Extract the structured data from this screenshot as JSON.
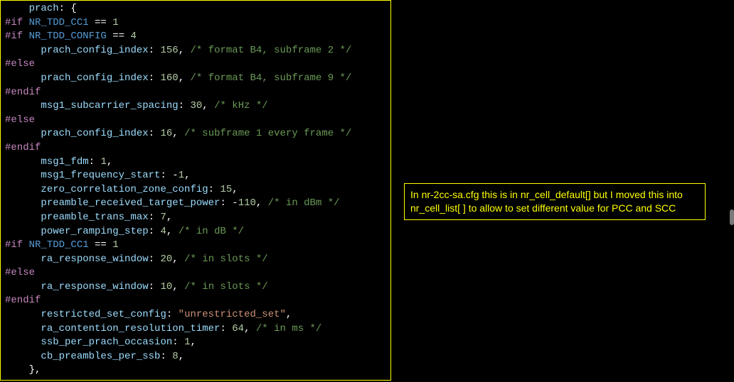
{
  "code": {
    "lines": [
      [
        [
          "tok-default",
          "    "
        ],
        [
          "tok-key",
          "prach"
        ],
        [
          "tok-default",
          ": {"
        ]
      ],
      [
        [
          "tok-preproc",
          "#if "
        ],
        [
          "tok-macro",
          "NR_TDD_CC1"
        ],
        [
          "tok-default",
          " == "
        ],
        [
          "tok-num",
          "1"
        ]
      ],
      [
        [
          "tok-preproc",
          "#if "
        ],
        [
          "tok-macro",
          "NR_TDD_CONFIG"
        ],
        [
          "tok-default",
          " == "
        ],
        [
          "tok-num",
          "4"
        ]
      ],
      [
        [
          "tok-default",
          "      "
        ],
        [
          "tok-key",
          "prach_config_index"
        ],
        [
          "tok-default",
          ": "
        ],
        [
          "tok-num",
          "156"
        ],
        [
          "tok-default",
          ", "
        ],
        [
          "tok-comment",
          "/* format B4, subframe 2 */"
        ]
      ],
      [
        [
          "tok-preproc",
          "#else"
        ]
      ],
      [
        [
          "tok-default",
          "      "
        ],
        [
          "tok-key",
          "prach_config_index"
        ],
        [
          "tok-default",
          ": "
        ],
        [
          "tok-num",
          "160"
        ],
        [
          "tok-default",
          ", "
        ],
        [
          "tok-comment",
          "/* format B4, subframe 9 */"
        ]
      ],
      [
        [
          "tok-preproc",
          "#endif"
        ]
      ],
      [
        [
          "tok-default",
          "      "
        ],
        [
          "tok-key",
          "msg1_subcarrier_spacing"
        ],
        [
          "tok-default",
          ": "
        ],
        [
          "tok-num",
          "30"
        ],
        [
          "tok-default",
          ", "
        ],
        [
          "tok-comment",
          "/* kHz */"
        ]
      ],
      [
        [
          "tok-preproc",
          "#else"
        ]
      ],
      [
        [
          "tok-default",
          "      "
        ],
        [
          "tok-key",
          "prach_config_index"
        ],
        [
          "tok-default",
          ": "
        ],
        [
          "tok-num",
          "16"
        ],
        [
          "tok-default",
          ", "
        ],
        [
          "tok-comment",
          "/* subframe 1 every frame */"
        ]
      ],
      [
        [
          "tok-preproc",
          "#endif"
        ]
      ],
      [
        [
          "tok-default",
          "      "
        ],
        [
          "tok-key",
          "msg1_fdm"
        ],
        [
          "tok-default",
          ": "
        ],
        [
          "tok-num",
          "1"
        ],
        [
          "tok-default",
          ","
        ]
      ],
      [
        [
          "tok-default",
          "      "
        ],
        [
          "tok-key",
          "msg1_frequency_start"
        ],
        [
          "tok-default",
          ": "
        ],
        [
          "tok-op",
          "-"
        ],
        [
          "tok-num",
          "1"
        ],
        [
          "tok-default",
          ","
        ]
      ],
      [
        [
          "tok-default",
          "      "
        ],
        [
          "tok-key",
          "zero_correlation_zone_config"
        ],
        [
          "tok-default",
          ": "
        ],
        [
          "tok-num",
          "15"
        ],
        [
          "tok-default",
          ","
        ]
      ],
      [
        [
          "tok-default",
          "      "
        ],
        [
          "tok-key",
          "preamble_received_target_power"
        ],
        [
          "tok-default",
          ": "
        ],
        [
          "tok-op",
          "-"
        ],
        [
          "tok-num",
          "110"
        ],
        [
          "tok-default",
          ", "
        ],
        [
          "tok-comment",
          "/* in dBm */"
        ]
      ],
      [
        [
          "tok-default",
          "      "
        ],
        [
          "tok-key",
          "preamble_trans_max"
        ],
        [
          "tok-default",
          ": "
        ],
        [
          "tok-num",
          "7"
        ],
        [
          "tok-default",
          ","
        ]
      ],
      [
        [
          "tok-default",
          "      "
        ],
        [
          "tok-key",
          "power_ramping_step"
        ],
        [
          "tok-default",
          ": "
        ],
        [
          "tok-num",
          "4"
        ],
        [
          "tok-default",
          ", "
        ],
        [
          "tok-comment",
          "/* in dB */"
        ]
      ],
      [
        [
          "tok-preproc",
          "#if "
        ],
        [
          "tok-macro",
          "NR_TDD_CC1"
        ],
        [
          "tok-default",
          " == "
        ],
        [
          "tok-num",
          "1"
        ]
      ],
      [
        [
          "tok-default",
          "      "
        ],
        [
          "tok-key",
          "ra_response_window"
        ],
        [
          "tok-default",
          ": "
        ],
        [
          "tok-num",
          "20"
        ],
        [
          "tok-default",
          ", "
        ],
        [
          "tok-comment",
          "/* in slots */"
        ]
      ],
      [
        [
          "tok-preproc",
          "#else"
        ]
      ],
      [
        [
          "tok-default",
          "      "
        ],
        [
          "tok-key",
          "ra_response_window"
        ],
        [
          "tok-default",
          ": "
        ],
        [
          "tok-num",
          "10"
        ],
        [
          "tok-default",
          ", "
        ],
        [
          "tok-comment",
          "/* in slots */"
        ]
      ],
      [
        [
          "tok-preproc",
          "#endif"
        ]
      ],
      [
        [
          "tok-default",
          "      "
        ],
        [
          "tok-key",
          "restricted_set_config"
        ],
        [
          "tok-default",
          ": "
        ],
        [
          "tok-str",
          "\"unrestricted_set\""
        ],
        [
          "tok-default",
          ","
        ]
      ],
      [
        [
          "tok-default",
          "      "
        ],
        [
          "tok-key",
          "ra_contention_resolution_timer"
        ],
        [
          "tok-default",
          ": "
        ],
        [
          "tok-num",
          "64"
        ],
        [
          "tok-default",
          ", "
        ],
        [
          "tok-comment",
          "/* in ms */"
        ]
      ],
      [
        [
          "tok-default",
          "      "
        ],
        [
          "tok-key",
          "ssb_per_prach_occasion"
        ],
        [
          "tok-default",
          ": "
        ],
        [
          "tok-num",
          "1"
        ],
        [
          "tok-default",
          ","
        ]
      ],
      [
        [
          "tok-default",
          "      "
        ],
        [
          "tok-key",
          "cb_preambles_per_ssb"
        ],
        [
          "tok-default",
          ": "
        ],
        [
          "tok-num",
          "8"
        ],
        [
          "tok-default",
          ","
        ]
      ],
      [
        [
          "tok-default",
          "    },"
        ]
      ]
    ]
  },
  "annotation": {
    "text": "In nr-2cc-sa.cfg this is in nr_cell_default[] but I moved this into nr_cell_list[ ] to allow to set different value for PCC and SCC"
  }
}
